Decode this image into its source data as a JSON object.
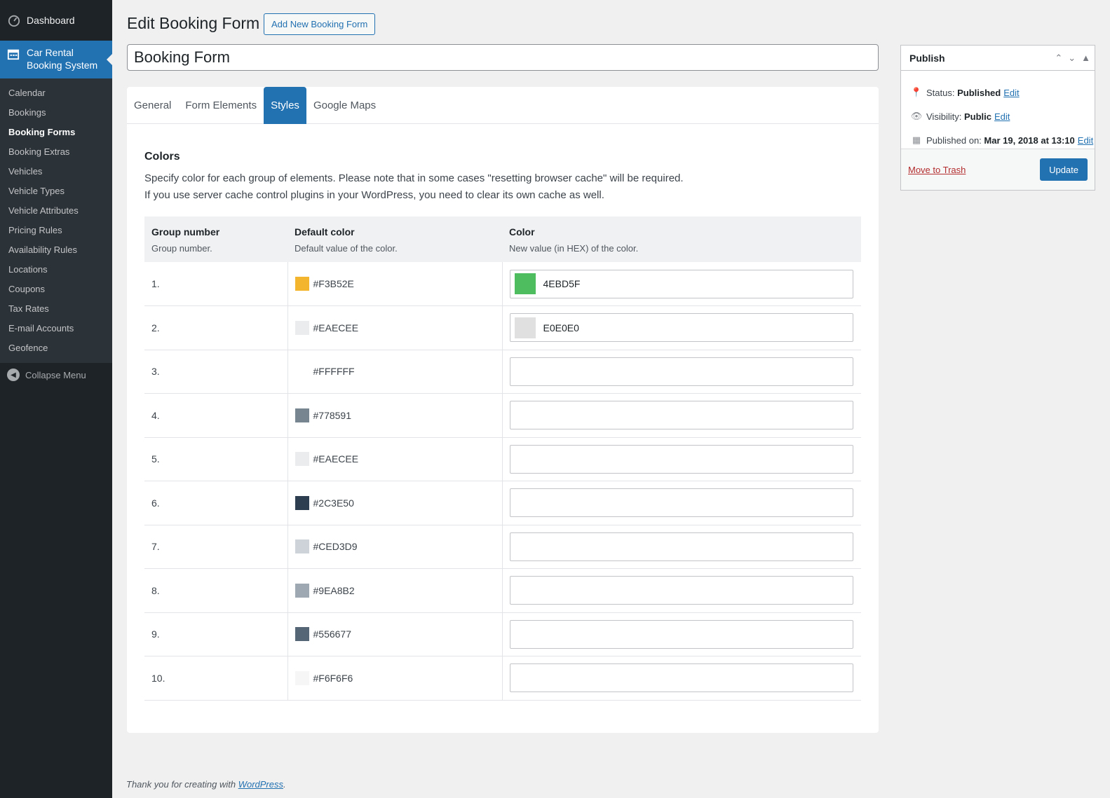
{
  "sidebar": {
    "dashboard": "Dashboard",
    "current": "Car Rental Booking System",
    "items": [
      {
        "label": "Calendar"
      },
      {
        "label": "Bookings"
      },
      {
        "label": "Booking Forms"
      },
      {
        "label": "Booking Extras"
      },
      {
        "label": "Vehicles"
      },
      {
        "label": "Vehicle Types"
      },
      {
        "label": "Vehicle Attributes"
      },
      {
        "label": "Pricing Rules"
      },
      {
        "label": "Availability Rules"
      },
      {
        "label": "Locations"
      },
      {
        "label": "Coupons"
      },
      {
        "label": "Tax Rates"
      },
      {
        "label": "E-mail Accounts"
      },
      {
        "label": "Geofence"
      }
    ],
    "collapse": "Collapse Menu"
  },
  "header": {
    "title": "Edit Booking Form",
    "add_new": "Add New Booking Form"
  },
  "post_title": "Booking Form",
  "tabs": [
    "General",
    "Form Elements",
    "Styles",
    "Google Maps"
  ],
  "section": {
    "heading": "Colors",
    "desc1": "Specify color for each group of elements. Please note that in some cases \"resetting browser cache\" will be required.",
    "desc2": "If you use server cache control plugins in your WordPress, you need to clear its own cache as well."
  },
  "table": {
    "headers": [
      {
        "title": "Group number",
        "sub": "Group number."
      },
      {
        "title": "Default color",
        "sub": "Default value of the color."
      },
      {
        "title": "Color",
        "sub": "New value (in HEX) of the color."
      }
    ],
    "rows": [
      {
        "num": "1.",
        "default": "#F3B52E",
        "value": "4EBD5F",
        "swatch": "#F3B52E",
        "preview": "#4EBD5F"
      },
      {
        "num": "2.",
        "default": "#EAECEE",
        "value": "E0E0E0",
        "swatch": "#EAECEE",
        "preview": "#E0E0E0"
      },
      {
        "num": "3.",
        "default": "#FFFFFF",
        "value": "",
        "swatch": "#FFFFFF",
        "preview": ""
      },
      {
        "num": "4.",
        "default": "#778591",
        "value": "",
        "swatch": "#778591",
        "preview": ""
      },
      {
        "num": "5.",
        "default": "#EAECEE",
        "value": "",
        "swatch": "#EAECEE",
        "preview": ""
      },
      {
        "num": "6.",
        "default": "#2C3E50",
        "value": "",
        "swatch": "#2C3E50",
        "preview": ""
      },
      {
        "num": "7.",
        "default": "#CED3D9",
        "value": "",
        "swatch": "#CED3D9",
        "preview": ""
      },
      {
        "num": "8.",
        "default": "#9EA8B2",
        "value": "",
        "swatch": "#9EA8B2",
        "preview": ""
      },
      {
        "num": "9.",
        "default": "#556677",
        "value": "",
        "swatch": "#556677",
        "preview": ""
      },
      {
        "num": "10.",
        "default": "#F6F6F6",
        "value": "",
        "swatch": "#F6F6F6",
        "preview": ""
      }
    ]
  },
  "publish": {
    "title": "Publish",
    "status_label": "Status:",
    "status_value": "Published",
    "visibility_label": "Visibility:",
    "visibility_value": "Public",
    "published_label": "Published on:",
    "published_value": "Mar 19, 2018 at 13:10",
    "edit": "Edit",
    "trash": "Move to Trash",
    "update": "Update"
  },
  "footer": {
    "text": "Thank you for creating with ",
    "link": "WordPress",
    "end": "."
  }
}
